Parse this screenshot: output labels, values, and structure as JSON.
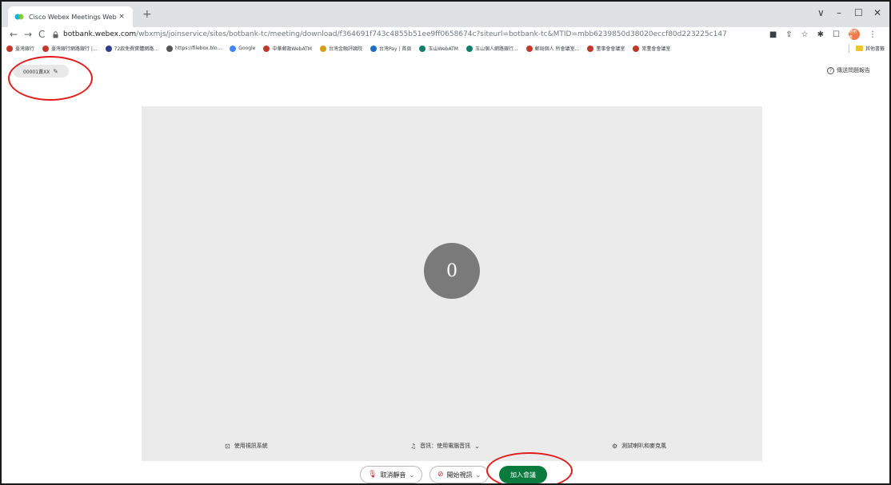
{
  "browser": {
    "tab": {
      "title": "Cisco Webex Meetings Web 應用程式",
      "close": "×"
    },
    "new_tab": "+",
    "window_controls": [
      "∨",
      "–",
      "☐",
      "✕"
    ],
    "nav": {
      "back": "←",
      "forward": "→",
      "reload": "C"
    },
    "url": {
      "host": "botbank.webex.com",
      "path": "/wbxmjs/joinservice/sites/botbank-tc/meeting/download/f364691f743c4855b51ee9ff0658674c?siteurl=botbank-tc&MTID=mbb6239850d38020eccf80d223225c147"
    },
    "profile_label": "使用者",
    "bookmarks": [
      {
        "label": "臺灣銀行",
        "color": "#c0392b"
      },
      {
        "label": "臺灣銀行網路銀行 |...",
        "color": "#c0392b"
      },
      {
        "label": "72款免費實體網路...",
        "color": "#2d3e8c"
      },
      {
        "label": "https://filebox.blo...",
        "color": "#555555"
      },
      {
        "label": "Google",
        "color": "#4285f4"
      },
      {
        "label": "中華郵政WebATM",
        "color": "#c0392b"
      },
      {
        "label": "台灣金融評論院",
        "color": "#d4a017"
      },
      {
        "label": "台灣Pay | 首頁",
        "color": "#1e6fc2"
      },
      {
        "label": "玉山WebATM",
        "color": "#11806a"
      },
      {
        "label": "玉山個人網路銀行...",
        "color": "#11806a"
      },
      {
        "label": "郵局個人 所會議室...",
        "color": "#c0392b"
      },
      {
        "label": "董事會會議室",
        "color": "#c0392b"
      },
      {
        "label": "常董會會議室",
        "color": "#c0392b"
      }
    ],
    "other_bookmarks": "其他書籤"
  },
  "page": {
    "display_name": "00001黃XX",
    "report_issue": "傳送問題報告",
    "avatar_initial": "0",
    "preview_options": {
      "video_system": "使用視訊系統",
      "audio": "音訊：使用電腦音訊",
      "test_audio": "測試喇叭和麥克風"
    },
    "controls": {
      "mute": "取消靜音",
      "start_video": "開始視訊",
      "join": "加入會議"
    }
  },
  "colors": {
    "join_button": "#0b7a3e",
    "annotation": "#e31b1b",
    "preview_bg": "#ebebeb",
    "avatar_bg": "#7a7a7a"
  }
}
